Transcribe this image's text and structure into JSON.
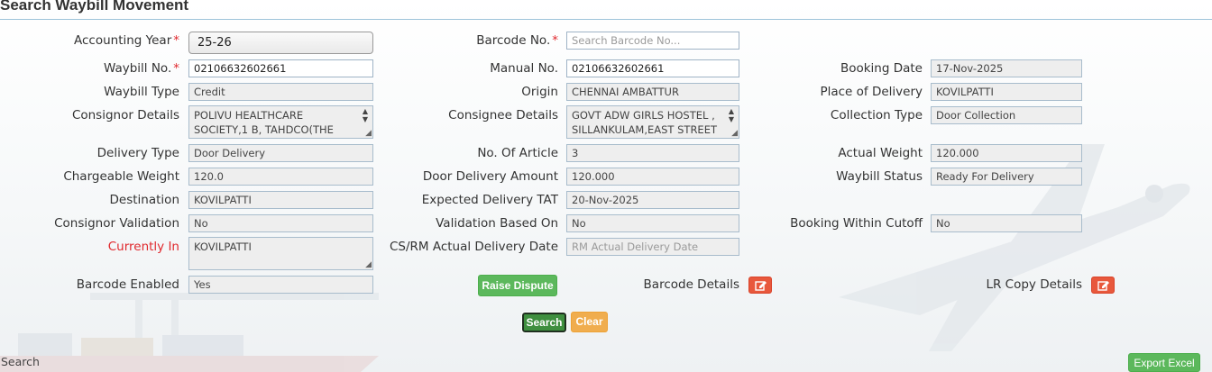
{
  "page": {
    "title": "Search Waybill Movement"
  },
  "form": {
    "accounting_year": {
      "label": "Accounting Year",
      "value": "25-26"
    },
    "barcode_no": {
      "label": "Barcode No.",
      "placeholder": "Search Barcode No..."
    },
    "waybill_no": {
      "label": "Waybill No.",
      "value": "02106632602661"
    },
    "manual_no": {
      "label": "Manual No.",
      "value": "02106632602661"
    },
    "booking_date": {
      "label": "Booking Date",
      "value": "17-Nov-2025"
    },
    "waybill_type": {
      "label": "Waybill Type",
      "value": "Credit"
    },
    "origin": {
      "label": "Origin",
      "value": "CHENNAI AMBATTUR"
    },
    "place_of_delivery": {
      "label": "Place of Delivery",
      "value": "KOVILPATTI"
    },
    "consignor_details": {
      "label": "Consignor Details",
      "line1": "POLIVU HEALTHCARE",
      "line2": "SOCIETY,1 B, TAHDCO(THE"
    },
    "consignee_details": {
      "label": "Consignee Details",
      "line1": "GOVT ADW GIRLS HOSTEL ,",
      "line2": "SILLANKULAM,EAST STREET"
    },
    "collection_type": {
      "label": "Collection Type",
      "value": "Door Collection"
    },
    "delivery_type": {
      "label": "Delivery Type",
      "value": "Door Delivery"
    },
    "no_of_article": {
      "label": "No. Of Article",
      "value": "3"
    },
    "actual_weight": {
      "label": "Actual Weight",
      "value": "120.000"
    },
    "chargeable_weight": {
      "label": "Chargeable Weight",
      "value": "120.0"
    },
    "door_delivery_amount": {
      "label": "Door Delivery Amount",
      "value": "120.000"
    },
    "waybill_status": {
      "label": "Waybill Status",
      "value": "Ready For Delivery"
    },
    "destination": {
      "label": "Destination",
      "value": "KOVILPATTI"
    },
    "expected_delivery_tat": {
      "label": "Expected Delivery TAT",
      "value": "20-Nov-2025"
    },
    "consignor_validation": {
      "label": "Consignor Validation",
      "value": "No"
    },
    "validation_based_on": {
      "label": "Validation Based On",
      "value": "No"
    },
    "booking_within_cutoff": {
      "label": "Booking Within Cutoff",
      "value": "No"
    },
    "currently_in": {
      "label": "Currently In",
      "value": "KOVILPATTI"
    },
    "cs_rm_actual_delivery_date": {
      "label": "CS/RM Actual Delivery Date",
      "placeholder": "RM Actual Delivery Date"
    },
    "barcode_enabled": {
      "label": "Barcode Enabled",
      "value": "Yes"
    },
    "barcode_details": {
      "label": "Barcode Details"
    },
    "lr_copy_details": {
      "label": "LR Copy Details"
    },
    "required_marker": "*"
  },
  "buttons": {
    "raise_dispute": "Raise Dispute",
    "search": "Search",
    "clear": "Clear",
    "export_excel": "Export Excel"
  },
  "footer": {
    "search_label": "Search"
  },
  "icons": {
    "edit": "edit-icon",
    "scroll": "scroll-arrows-icon"
  },
  "colors": {
    "required": "#e0282d",
    "green": "#5cb85c",
    "orange": "#f0ad4e",
    "red_icon": "#e8583c"
  }
}
